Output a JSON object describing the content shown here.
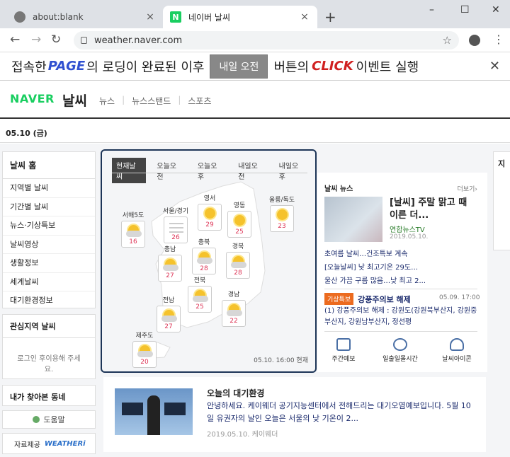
{
  "browser": {
    "tabs": [
      {
        "title": "about:blank",
        "close": "×"
      },
      {
        "title": "네이버 날씨",
        "close": "×",
        "favicon": "N"
      }
    ],
    "new_tab": "+",
    "window_controls": {
      "minimize": "–",
      "maximize": "☐",
      "close": "✕"
    },
    "url": "weather.naver.com",
    "nav": {
      "back": "←",
      "forward": "→",
      "reload": "↻"
    },
    "bookmark": "☆",
    "menu": "⋮"
  },
  "banner": {
    "part1": "접속한",
    "page": "PAGE",
    "part2": "의 로딩이 완료된 이후",
    "button": "내일 오전",
    "part3": "버튼의",
    "click": "CLICK",
    "part4": "이벤트 실행",
    "close": "✕"
  },
  "header": {
    "logo": "NAVER",
    "service": "날씨",
    "gnb": [
      "뉴스",
      "뉴스스탠드",
      "스포츠"
    ],
    "date": "05.10 (금)"
  },
  "sidebar": {
    "home": "날씨 홈",
    "items": [
      "지역별 날씨",
      "기간별 날씨",
      "뉴스·기상특보",
      "날씨영상",
      "생활정보",
      "세계날씨",
      "대기환경정보"
    ],
    "fav_title": "관심지역 날씨",
    "fav_text": "로그인 후이용해 주세요.",
    "recent": "내가 찾아본 동네",
    "help": "도움말",
    "source_label": "자료제공",
    "source_logo": "WEATHERi"
  },
  "map": {
    "tabs": [
      "현재날씨",
      "오늘오전",
      "오늘오후",
      "내일오전",
      "내일오후"
    ],
    "cities": [
      {
        "name": "서해5도",
        "temp": "16",
        "icon": "partly-cloudy"
      },
      {
        "name": "서울/경기",
        "temp": "26",
        "icon": "haze"
      },
      {
        "name": "영서",
        "temp": "29",
        "icon": "sunny"
      },
      {
        "name": "영동",
        "temp": "25",
        "icon": "sunny"
      },
      {
        "name": "울릉/독도",
        "temp": "23",
        "icon": "sunny"
      },
      {
        "name": "충남",
        "temp": "27",
        "icon": "partly-sunny"
      },
      {
        "name": "충북",
        "temp": "28",
        "icon": "partly-sunny"
      },
      {
        "name": "경북",
        "temp": "28",
        "icon": "partly-sunny"
      },
      {
        "name": "전북",
        "temp": "25",
        "icon": "partly-sunny"
      },
      {
        "name": "전남",
        "temp": "27",
        "icon": "partly-sunny"
      },
      {
        "name": "경남",
        "temp": "22",
        "icon": "partly-sunny"
      },
      {
        "name": "제주도",
        "temp": "20",
        "icon": "partly-sunny"
      }
    ],
    "updated": "05.10. 16:00 현재"
  },
  "news": {
    "title": "날씨 뉴스",
    "more": "더보기›",
    "headline": "[날씨] 주말 맑고 때 이른 더...",
    "source": "연합뉴스TV",
    "date": "2019.05.10.",
    "items": [
      "초여름 날씨…건조특보 계속",
      "[오늘날씨] 낮 최고기온 29도…",
      "울산 가끔 구름 많음…낮 최고 2..."
    ],
    "alert_tag": "기상특보",
    "alert_title": "강풍주의보 해제",
    "alert_date": "05.09. 17:00",
    "alert_text": "(1) 강풍주의보 해제 : 강원도(강원북부산지, 강원중부산지, 강원남부산지, 정선평",
    "shortcuts": [
      {
        "label": "주간예보",
        "icon": "calendar-icon"
      },
      {
        "label": "일출일몰시간",
        "icon": "clock-icon"
      },
      {
        "label": "날씨아이콘",
        "icon": "cloud-icon"
      }
    ]
  },
  "air": {
    "title": "오늘의 대기환경",
    "text": "안녕하세요. 케이웨더 공기지능센터에서 전해드리는 대기오염예보입니다. 5월 10일 유권자의 날인 오늘은 서울의 낮 기온이 2...",
    "date": "2019.05.10. 케이웨더"
  },
  "right_partial": {
    "title": "지"
  }
}
